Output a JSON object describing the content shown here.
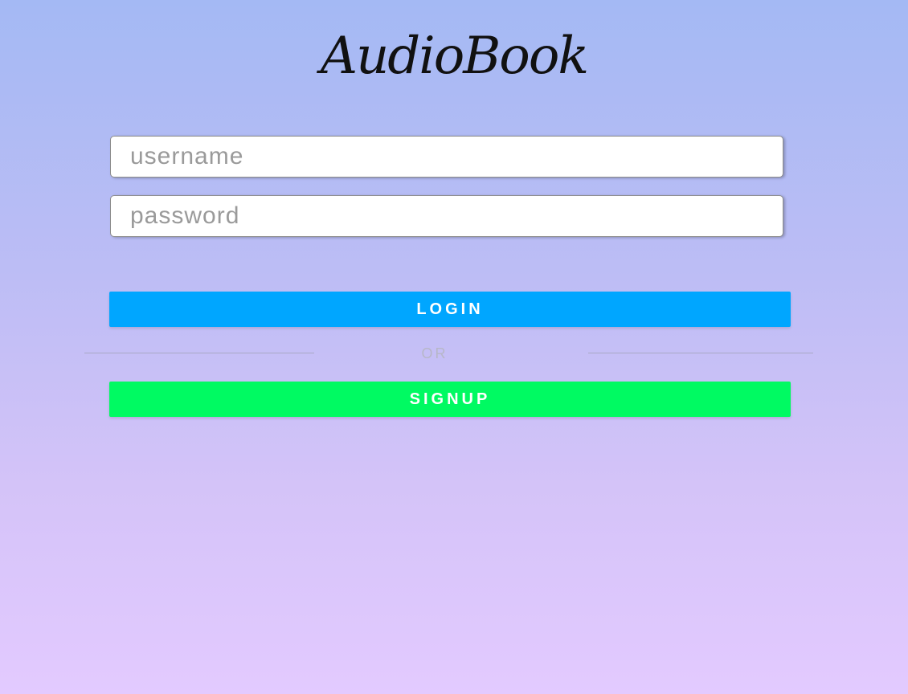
{
  "app": {
    "title": "AudioBook"
  },
  "form": {
    "username": {
      "placeholder": "username",
      "value": ""
    },
    "password": {
      "placeholder": "password",
      "value": ""
    }
  },
  "buttons": {
    "login_label": "LOGIN",
    "signup_label": "SIGNUP"
  },
  "divider": {
    "label": "OR"
  },
  "colors": {
    "login_button": "#00a6ff",
    "signup_button": "#00fa62",
    "background_top": "#a4b9f4",
    "background_bottom": "#e3caff"
  }
}
